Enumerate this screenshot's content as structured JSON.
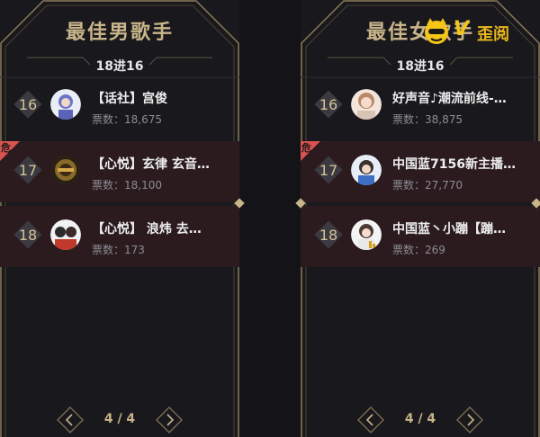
{
  "panels": [
    {
      "title": "最佳男歌手",
      "subtitle": "18进16",
      "rows": [
        {
          "rank": "16",
          "name": "【话社】宫俊",
          "votes": "票数：18,675",
          "danger": false
        },
        {
          "rank": "17",
          "name": "【心悦】玄律 玄音…",
          "votes": "票数：18,100",
          "danger": true
        },
        {
          "rank": "18",
          "name": "【心悦】 浪炜 去…",
          "votes": "票数：173",
          "danger": true
        }
      ],
      "pager": "4 / 4"
    },
    {
      "title": "最佳女歌手",
      "subtitle": "18进16",
      "rows": [
        {
          "rank": "16",
          "name": "好声音♪潮流前线-…",
          "votes": "票数：38,875",
          "danger": false
        },
        {
          "rank": "17",
          "name": "中国蓝7156新主播…",
          "votes": "票数：27,770",
          "danger": true
        },
        {
          "rank": "18",
          "name": "中国蓝丶小蹦【蹦…",
          "votes": "票数：269",
          "danger": true
        }
      ],
      "pager": "4 / 4"
    }
  ],
  "danger_label": "危",
  "watermark": {
    "v": "V",
    "text": "歪阅"
  },
  "colors": {
    "gold": "#c9b58a",
    "danger_red": "#d9534f",
    "row_danger_bg": "#2b1b1f"
  }
}
